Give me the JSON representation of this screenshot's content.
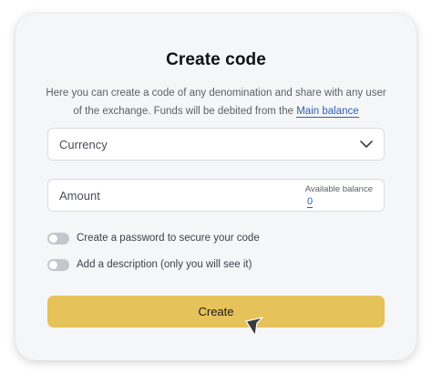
{
  "dialog": {
    "title": "Create code",
    "description": "Here you can create a code of any denomination and share with any user of the exchange. Funds will be debited from the ",
    "description_link": "Main balance"
  },
  "currency_select": {
    "placeholder": "Currency",
    "icon": "chevron-down-icon"
  },
  "amount_field": {
    "placeholder": "Amount",
    "balance_caption": "Available balance",
    "balance_value": "0"
  },
  "options": [
    {
      "label": "Create a password to secure your code",
      "enabled": false
    },
    {
      "label": "Add a description (only you will see it)",
      "enabled": false
    }
  ],
  "create_button": {
    "label": "Create"
  },
  "colors": {
    "accent": "#e6c25b",
    "link": "#2f5fb3",
    "card_bg": "#f5f6f8"
  }
}
